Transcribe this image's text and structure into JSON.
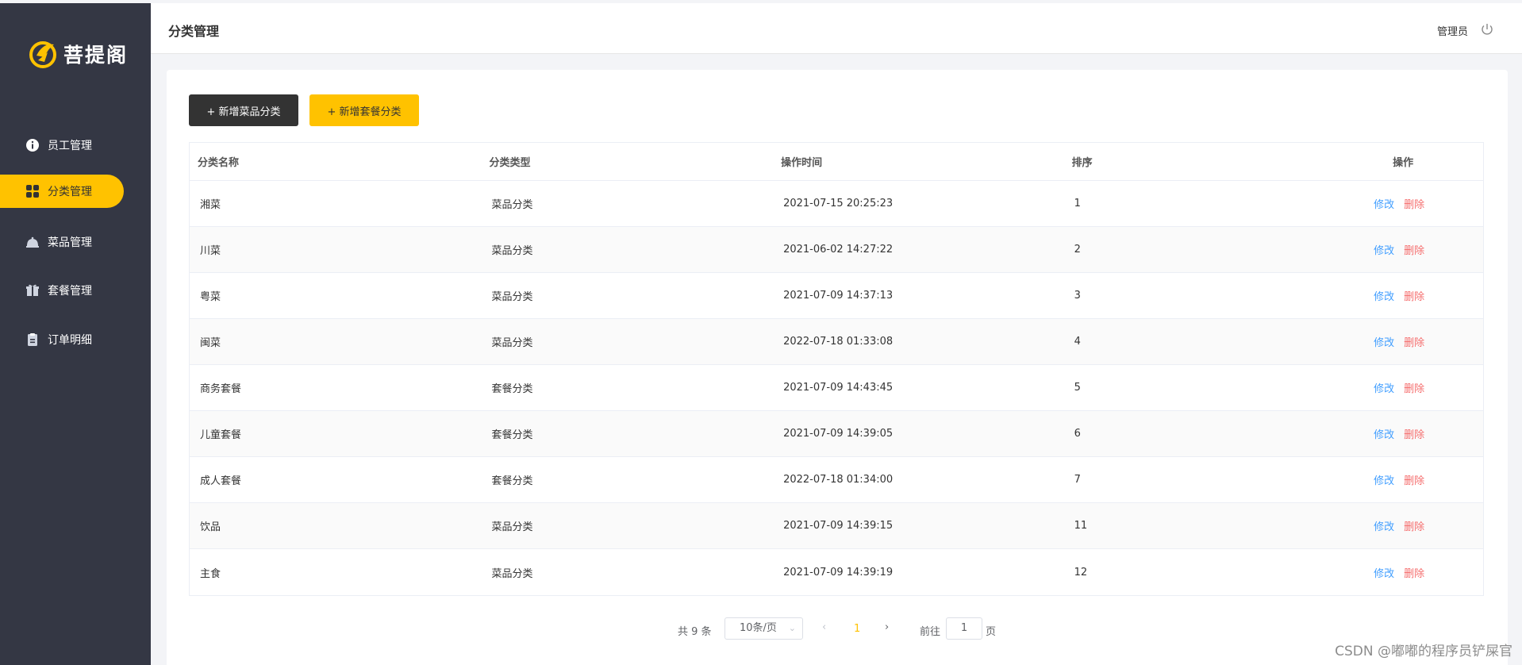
{
  "brand": {
    "name": "菩提阁",
    "accent": "#ffc200"
  },
  "sidebar": {
    "items": [
      {
        "label": "员工管理",
        "icon": "info-circle-icon"
      },
      {
        "label": "分类管理",
        "icon": "grid-icon"
      },
      {
        "label": "菜品管理",
        "icon": "cloche-icon"
      },
      {
        "label": "套餐管理",
        "icon": "gift-icon"
      },
      {
        "label": "订单明细",
        "icon": "clipboard-icon"
      }
    ],
    "active_index": 1
  },
  "header": {
    "title": "分类管理",
    "user": "管理员",
    "logout_icon": "power-icon"
  },
  "toolbar": {
    "add_dish_category": "+ 新增菜品分类",
    "add_setmeal_category": "+ 新增套餐分类"
  },
  "table": {
    "columns": [
      "分类名称",
      "分类类型",
      "操作时间",
      "排序",
      "操作"
    ],
    "rows": [
      {
        "name": "湘菜",
        "type": "菜品分类",
        "time": "2021-07-15 20:25:23",
        "sort": "1"
      },
      {
        "name": "川菜",
        "type": "菜品分类",
        "time": "2021-06-02 14:27:22",
        "sort": "2"
      },
      {
        "name": "粤菜",
        "type": "菜品分类",
        "time": "2021-07-09 14:37:13",
        "sort": "3"
      },
      {
        "name": "闽菜",
        "type": "菜品分类",
        "time": "2022-07-18 01:33:08",
        "sort": "4"
      },
      {
        "name": "商务套餐",
        "type": "套餐分类",
        "time": "2021-07-09 14:43:45",
        "sort": "5"
      },
      {
        "name": "儿童套餐",
        "type": "套餐分类",
        "time": "2021-07-09 14:39:05",
        "sort": "6"
      },
      {
        "name": "成人套餐",
        "type": "套餐分类",
        "time": "2022-07-18 01:34:00",
        "sort": "7"
      },
      {
        "name": "饮品",
        "type": "菜品分类",
        "time": "2021-07-09 14:39:15",
        "sort": "11"
      },
      {
        "name": "主食",
        "type": "菜品分类",
        "time": "2021-07-09 14:39:19",
        "sort": "12"
      }
    ],
    "edit_label": "修改",
    "delete_label": "删除"
  },
  "pagination": {
    "total": "共 9 条",
    "page_size": "10条/页",
    "current_page": "1",
    "goto_label": "前往",
    "goto_value": "1",
    "goto_unit": "页"
  },
  "watermark": "CSDN @嘟嘟的程序员铲屎官"
}
